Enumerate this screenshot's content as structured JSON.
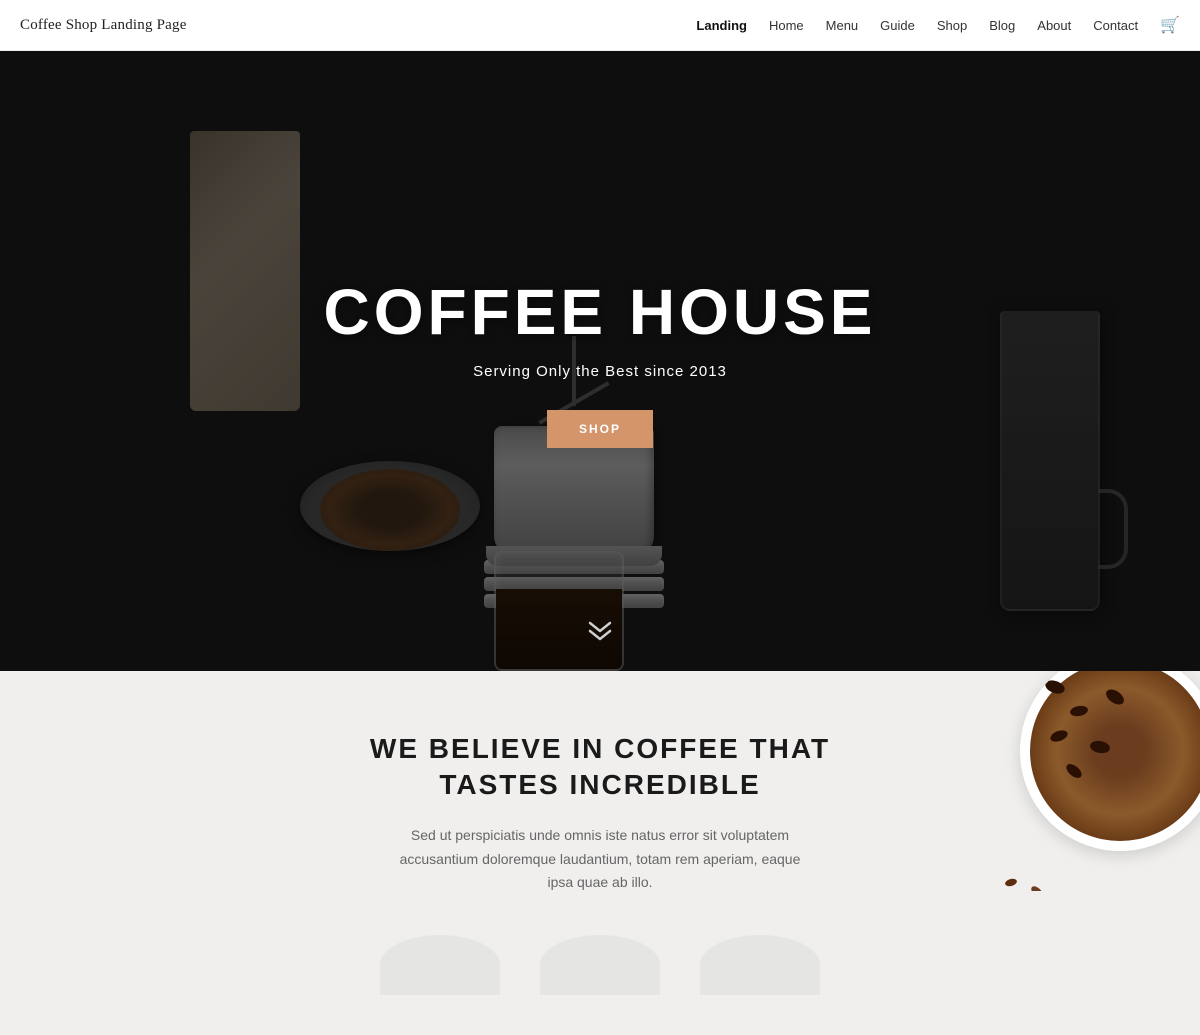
{
  "site": {
    "title": "Coffee Shop Landing Page"
  },
  "nav": {
    "items": [
      {
        "label": "Landing",
        "active": true
      },
      {
        "label": "Home",
        "active": false
      },
      {
        "label": "Menu",
        "active": false
      },
      {
        "label": "Guide",
        "active": false
      },
      {
        "label": "Shop",
        "active": false
      },
      {
        "label": "Blog",
        "active": false
      },
      {
        "label": "About",
        "active": false
      },
      {
        "label": "Contact",
        "active": false
      }
    ]
  },
  "hero": {
    "title": "COFFEE HOUSE",
    "subtitle": "Serving Only the Best since 2013",
    "cta_label": "SHOP"
  },
  "about": {
    "title": "WE BELIEVE IN COFFEE THAT TASTES INCREDIBLE",
    "body": "Sed ut perspiciatis unde omnis iste natus error sit voluptatem accusantium doloremque laudantium, totam rem aperiam, eaque ipsa quae ab illo."
  },
  "colors": {
    "accent": "#d4956a",
    "dark": "#1a1a1a",
    "light_bg": "#f0efed"
  }
}
